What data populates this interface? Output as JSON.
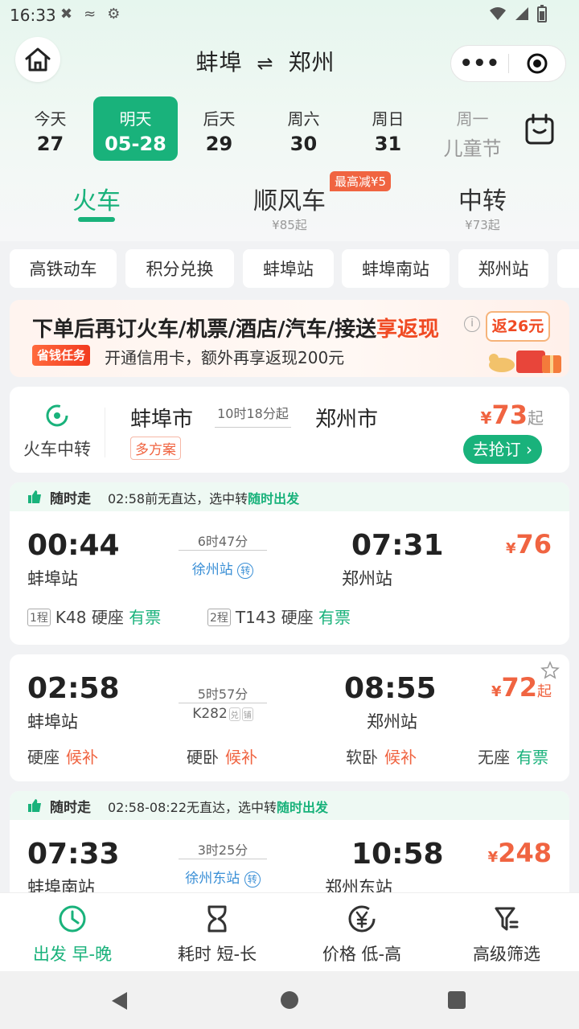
{
  "status": {
    "time": "16:33"
  },
  "header": {
    "from": "蚌埠",
    "swap": "⇌",
    "to": "郑州",
    "capsule_more": "•••"
  },
  "dates": [
    {
      "label": "今天",
      "num": "27"
    },
    {
      "label": "明天",
      "num": "05-28",
      "active": true
    },
    {
      "label": "后天",
      "num": "29"
    },
    {
      "label": "周六",
      "num": "30"
    },
    {
      "label": "周日",
      "num": "31"
    },
    {
      "label": "周一",
      "num": "儿童节"
    }
  ],
  "modes": [
    {
      "label": "火车",
      "sub": ""
    },
    {
      "label": "顺风车",
      "sub": "¥85起",
      "tag": "最高减¥5"
    },
    {
      "label": "中转",
      "sub": "¥73起"
    }
  ],
  "chips": [
    "高铁动车",
    "积分兑换",
    "蚌埠站",
    "蚌埠南站",
    "郑州站"
  ],
  "banner": {
    "title_main": "下单后再订火车/机票/酒店/汽车/接送",
    "title_highlight": "享返现",
    "tag": "省钱任务",
    "sub": "开通信用卡，额外再享返现200元",
    "info": "i",
    "reward": "返26元"
  },
  "transfer_card": {
    "label": "火车中转",
    "from": "蚌埠市",
    "to": "郑州市",
    "duration": "10时18分起",
    "multi": "多方案",
    "price_symbol": "¥",
    "price": "73",
    "price_suffix": "起",
    "button": "去抢订 ›"
  },
  "trains": [
    {
      "tip_title": "随时走",
      "tip_text": "02:58前无直达，选中转",
      "tip_highlight": "随时出发",
      "dep_time": "00:44",
      "dep_station": "蚌埠站",
      "duration": "6时47分",
      "via": "徐州站",
      "via_badge": "转",
      "arr_time": "07:31",
      "arr_station": "郑州站",
      "price_symbol": "¥",
      "price": "76",
      "legs": [
        {
          "no": "1程",
          "train": "K48",
          "seat": "硬座",
          "status": "有票"
        },
        {
          "no": "2程",
          "train": "T143",
          "seat": "硬座",
          "status": "有票"
        }
      ]
    },
    {
      "dep_time": "02:58",
      "dep_station": "蚌埠站",
      "duration": "5时57分",
      "code": "K282",
      "code_tags": [
        "兑",
        "铺"
      ],
      "arr_time": "08:55",
      "arr_station": "郑州站",
      "price_symbol": "¥",
      "price": "72",
      "price_suffix": "起",
      "seats": [
        {
          "type": "硬座",
          "status": "候补"
        },
        {
          "type": "硬卧",
          "status": "候补"
        },
        {
          "type": "软卧",
          "status": "候补"
        },
        {
          "type": "无座",
          "status": "有票"
        }
      ]
    },
    {
      "tip_title": "随时走",
      "tip_text": "02:58-08:22无直达，选中转",
      "tip_highlight": "随时出发",
      "dep_time": "07:33",
      "dep_station": "蚌埠南站",
      "duration": "3时25分",
      "via": "徐州东站",
      "via_badge": "转",
      "arr_time": "10:58",
      "arr_station": "郑州东站",
      "price_symbol": "¥",
      "price": "248"
    }
  ],
  "toolbar": [
    {
      "label": "出发 早-晚",
      "icon": "clock-icon"
    },
    {
      "label": "耗时 短-长",
      "icon": "hourglass-icon"
    },
    {
      "label": "价格 低-高",
      "icon": "yen-icon"
    },
    {
      "label": "高级筛选",
      "icon": "filter-icon"
    }
  ],
  "colors": {
    "accent": "#19b27b",
    "price": "#f06441"
  }
}
